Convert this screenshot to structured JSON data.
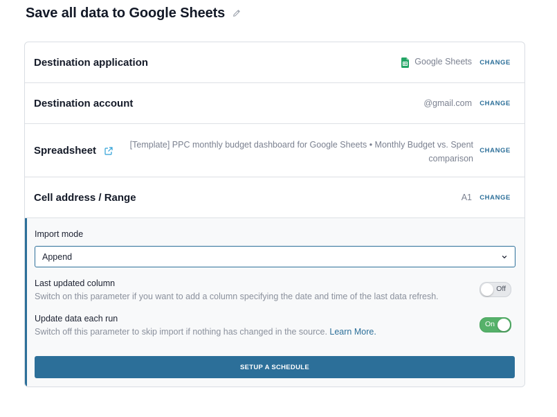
{
  "page": {
    "title": "Save all data to Google Sheets"
  },
  "rows": [
    {
      "label": "Destination application",
      "value": "Google Sheets",
      "action": "CHANGE"
    },
    {
      "label": "Destination account",
      "value": "@gmail.com",
      "action": "CHANGE"
    },
    {
      "label": "Spreadsheet",
      "value": "[Template] PPC monthly budget dashboard for Google Sheets • Monthly Budget vs. Spent comparison",
      "action": "CHANGE"
    },
    {
      "label": "Cell address / Range",
      "value": "A1",
      "action": "CHANGE"
    }
  ],
  "import_mode": {
    "label": "Import mode",
    "selected": "Append"
  },
  "last_updated": {
    "title": "Last updated column",
    "description": "Switch on this parameter if you want to add a column specifying the date and time of the last data refresh.",
    "toggle_text": "Off",
    "state": "off"
  },
  "update_each_run": {
    "title": "Update data each run",
    "description": "Switch off this parameter to skip import if nothing has changed in the source.",
    "link_text": "Learn More.",
    "toggle_text": "On",
    "state": "on"
  },
  "schedule_button": "SETUP A SCHEDULE",
  "colors": {
    "accent": "#2c6f99",
    "toggle_on": "#56b16a",
    "sheets_green": "#23a566"
  },
  "icons": [
    "pencil-icon",
    "google-sheets-icon",
    "external-link-icon",
    "chevron-down-icon"
  ]
}
